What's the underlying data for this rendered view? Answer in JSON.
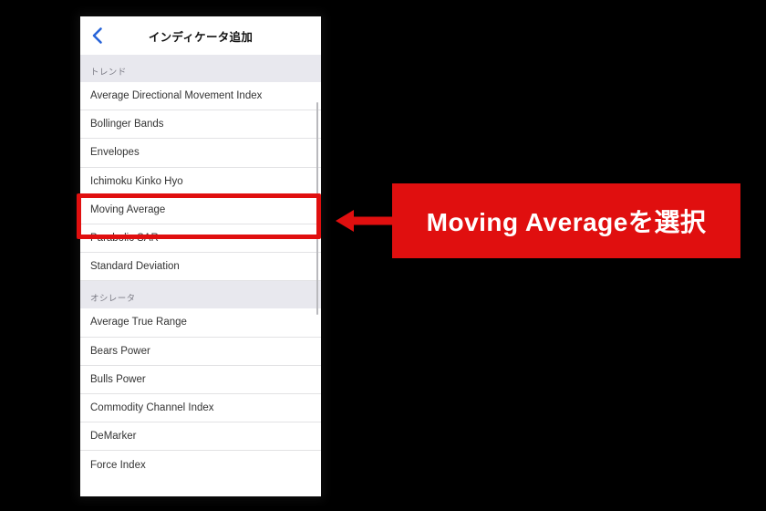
{
  "screen": {
    "background_color": "#000000",
    "panel_background": "#ffffff"
  },
  "phone": {
    "nav": {
      "back_icon": "chevron-left-icon",
      "back_icon_color": "#2864d8",
      "title": "インディケータ追加"
    },
    "scroll_indicator": "visible",
    "sections": [
      {
        "header": "トレンド",
        "items": [
          "Average Directional Movement Index",
          "Bollinger Bands",
          "Envelopes",
          "Ichimoku Kinko Hyo",
          "Moving Average",
          "Parabolic SAR",
          "Standard Deviation"
        ]
      },
      {
        "header": "オシレータ",
        "items": [
          "Average True Range",
          "Bears Power",
          "Bulls Power",
          "Commodity Channel Index",
          "DeMarker",
          "Force Index"
        ]
      }
    ]
  },
  "annotation": {
    "highlight_target": "Moving Average",
    "highlight_color": "#e00f0f",
    "arrow_icon": "arrow-left-icon",
    "arrow_color": "#e00f0f",
    "callout_text": "Moving Averageを選択",
    "callout_background": "#e00f0f",
    "callout_text_color": "#ffffff"
  }
}
